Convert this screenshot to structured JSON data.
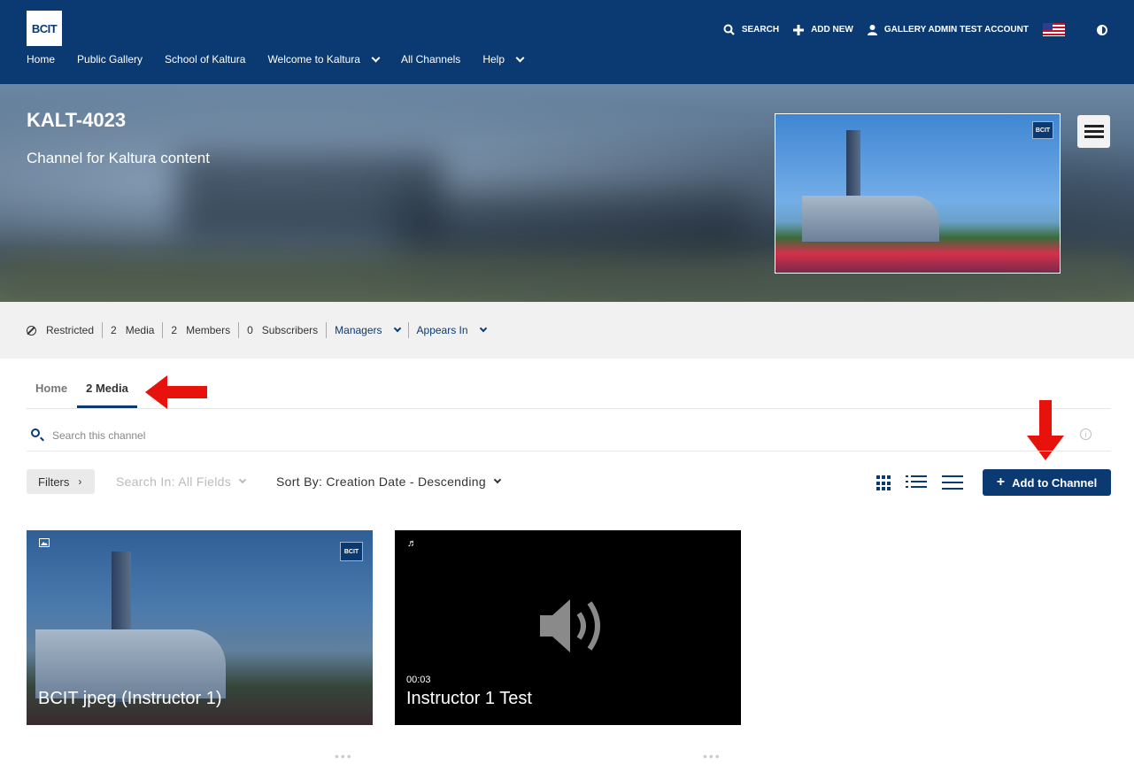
{
  "header": {
    "logo_text": "BCIT",
    "nav": [
      "Home",
      "Public Gallery",
      "School of Kaltura",
      "Welcome to Kaltura",
      "All Channels",
      "Help"
    ],
    "utility": {
      "search_label": "SEARCH",
      "add_new_label": "ADD NEW",
      "account_label": "GALLERY ADMIN TEST ACCOUNT"
    }
  },
  "channel": {
    "title": "KALT-4023",
    "description": "Channel for Kaltura content",
    "thumbnail_badge": "BCIT"
  },
  "info_bar": {
    "privacy": "Restricted",
    "media_count": "2",
    "media_label": "Media",
    "members_count": "2",
    "members_label": "Members",
    "subscribers_count": "0",
    "subscribers_label": "Subscribers",
    "managers_label": "Managers",
    "appears_in_label": "Appears In"
  },
  "tabs": [
    {
      "label": "Home",
      "active": false
    },
    {
      "label": "2 Media",
      "active": true
    }
  ],
  "search": {
    "placeholder": "Search this channel"
  },
  "toolbar": {
    "filters_label": "Filters",
    "search_in_label": "Search In: All Fields",
    "sort_by_label": "Sort By: Creation Date - Descending",
    "add_to_channel_label": "Add to Channel"
  },
  "media": [
    {
      "title": "BCIT jpeg (Instructor 1)",
      "type": "image",
      "badge": "BCIT"
    },
    {
      "title": "Instructor 1 Test",
      "type": "audio",
      "duration": "00:03"
    }
  ],
  "colors": {
    "brand": "#0b3a73",
    "annotation_arrow": "#e8120c"
  }
}
